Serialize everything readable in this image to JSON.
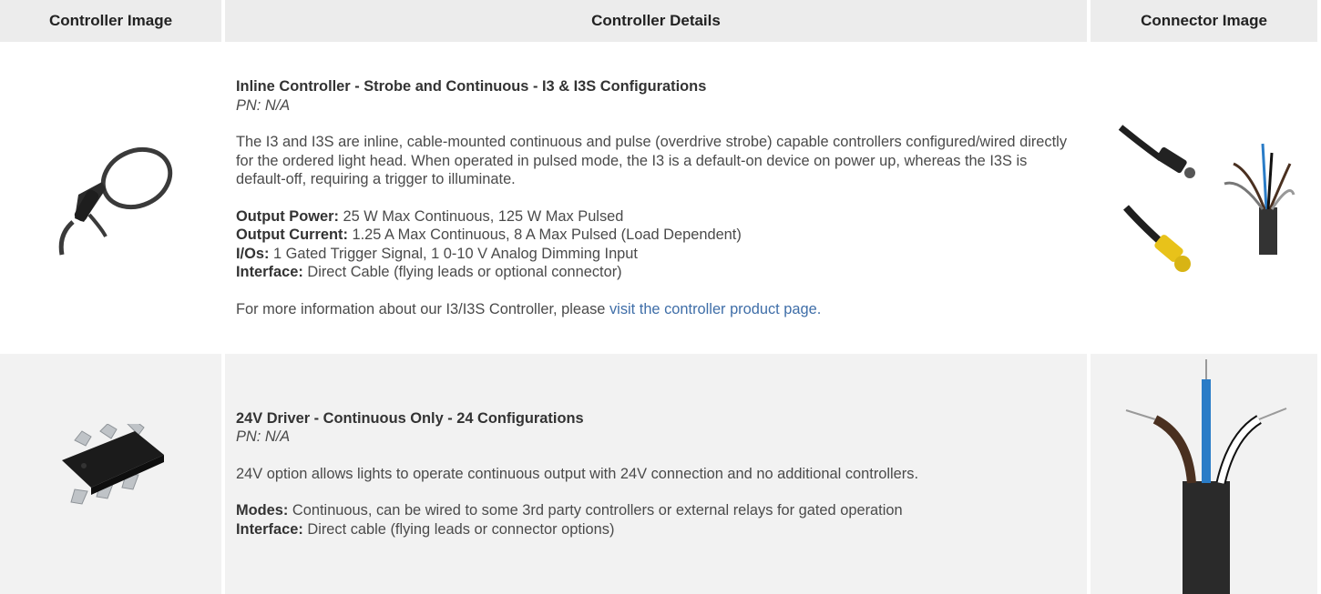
{
  "headers": {
    "controller_image": "Controller Image",
    "controller_details": "Controller Details",
    "connector_image": "Connector Image"
  },
  "rows": [
    {
      "title": "Inline Controller - Strobe and Continuous - I3 & I3S Configurations",
      "pn": "PN: N/A",
      "description": "The I3 and I3S are inline, cable-mounted continuous and pulse (overdrive strobe) capable controllers configured/wired directly for the ordered light head. When operated in pulsed mode, the I3 is a default-on device on power up, whereas the I3S is default-off, requiring a trigger to illuminate.",
      "specs": [
        {
          "label": "Output Power:",
          "value": " 25 W Max Continuous, 125 W Max Pulsed"
        },
        {
          "label": "Output Current:",
          "value": " 1.25 A Max Continuous, 8 A Max Pulsed (Load Dependent)"
        },
        {
          "label": "I/Os:",
          "value": " 1 Gated Trigger Signal, 1 0-10 V Analog Dimming Input"
        },
        {
          "label": "Interface:",
          "value": " Direct Cable (flying leads or optional connector)"
        }
      ],
      "more_info_prefix": "For more information about our I3/I3S Controller, please ",
      "more_info_link": "visit the controller product page."
    },
    {
      "title": "24V Driver - Continuous Only - 24 Configurations",
      "pn": "PN: N/A",
      "description": "24V option allows lights to operate continuous output with 24V connection and no additional controllers.",
      "specs": [
        {
          "label": "Modes:",
          "value": " Continuous, can be wired to some 3rd party controllers or external relays for gated operation"
        },
        {
          "label": "Interface:",
          "value": " Direct cable (flying leads or connector options)"
        }
      ]
    }
  ],
  "colors": {
    "header_bg": "#ececec",
    "row2_bg": "#f2f2f2",
    "link": "#3f6ea8",
    "wire_blue": "#2a7cc7",
    "wire_brown": "#4a3020",
    "connector_yellow": "#e8c21a"
  }
}
